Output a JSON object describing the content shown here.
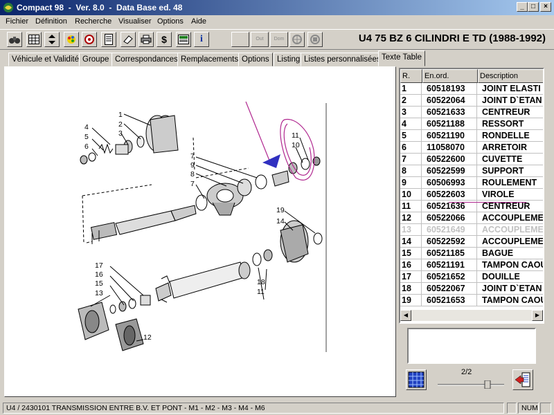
{
  "window": {
    "title": "Compact 98  -  Ver. 8.0  -  Data Base ed. 48",
    "controls": [
      "_",
      "□",
      "×"
    ]
  },
  "menu": [
    "Fichier",
    "Définition",
    "Recherche",
    "Visualiser",
    "Options",
    "Aide"
  ],
  "toolbar": {
    "icons": [
      "binoculars-icon",
      "grid-icon",
      "sort-icon",
      "palette-icon",
      "target-icon",
      "document-icon",
      "eraser-icon",
      "print-icon",
      "dollar-icon",
      "screen-icon",
      "info-icon"
    ],
    "dollar_label": "$",
    "info_label": "i",
    "disabled_labels": [
      "",
      "Out",
      "Dom"
    ]
  },
  "vehicle_title": "U4 75 BZ 6 CILINDRI E TD (1988-1992)",
  "tabs": [
    "Véhicule et Validité",
    "Groupe",
    "Correspondances",
    "Remplacements",
    "Options",
    "Listing",
    "Listes personnalisées",
    "Texte Table"
  ],
  "active_tab": "Texte Table",
  "grid": {
    "headers": [
      "R.",
      "En.ord.",
      "Description"
    ],
    "rows": [
      {
        "r": "1",
        "code": "60518193",
        "desc": "JOINT ELASTI"
      },
      {
        "r": "2",
        "code": "60522064",
        "desc": "JOINT D`ETAN"
      },
      {
        "r": "3",
        "code": "60521633",
        "desc": "CENTREUR"
      },
      {
        "r": "4",
        "code": "60521188",
        "desc": "RESSORT"
      },
      {
        "r": "5",
        "code": "60521190",
        "desc": "RONDELLE"
      },
      {
        "r": "6",
        "code": "11058070",
        "desc": "ARRETOIR"
      },
      {
        "r": "7",
        "code": "60522600",
        "desc": "CUVETTE"
      },
      {
        "r": "8",
        "code": "60522599",
        "desc": "SUPPORT"
      },
      {
        "r": "9",
        "code": "60506993",
        "desc": "ROULEMENT"
      },
      {
        "r": "10",
        "code": "60522603",
        "desc": "VIROLE"
      },
      {
        "r": "11",
        "code": "60521636",
        "desc": "CENTREUR"
      },
      {
        "r": "12",
        "code": "60522066",
        "desc": "ACCOUPLEME"
      },
      {
        "r": "13",
        "code": "60521649",
        "desc": "ACCOUPLEME",
        "disabled": true
      },
      {
        "r": "14",
        "code": "60522592",
        "desc": "ACCOUPLEME"
      },
      {
        "r": "15",
        "code": "60521185",
        "desc": "BAGUE"
      },
      {
        "r": "16",
        "code": "60521191",
        "desc": "TAMPON CAOU"
      },
      {
        "r": "17",
        "code": "60521652",
        "desc": "DOUILLE"
      },
      {
        "r": "18",
        "code": "60522067",
        "desc": "JOINT D`ETAN"
      },
      {
        "r": "19",
        "code": "60521653",
        "desc": "TAMPON CAOU"
      }
    ]
  },
  "diagram": {
    "callouts": [
      "1",
      "2",
      "3",
      "4",
      "5",
      "6",
      "7",
      "9",
      "8",
      "7",
      "11",
      "10",
      "19",
      "14",
      "17",
      "16",
      "15",
      "13",
      "18",
      "11",
      "12"
    ]
  },
  "pager": "2/2",
  "status": {
    "text": "U4 / 2430101  TRANSMISSION ENTRE B.V. ET PONT  - M1 - M2 - M3 - M4 - M6",
    "num": "NUM"
  },
  "colors": {
    "titlebar_start": "#0a246a",
    "titlebar_end": "#a6caf0",
    "annotation": "#b0278f",
    "face": "#d4d0c8"
  }
}
